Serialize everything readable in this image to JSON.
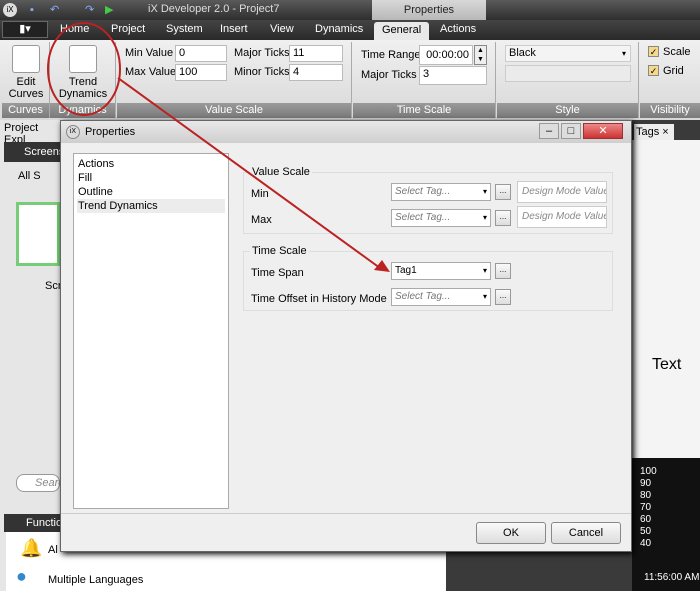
{
  "window": {
    "title": "iX Developer 2.0 - Project7",
    "context_tab": "Properties"
  },
  "tabs": [
    "Home",
    "Project",
    "System",
    "Insert",
    "View",
    "Dynamics",
    "General",
    "Actions"
  ],
  "ribbon": {
    "curves": {
      "edit_curves": "Edit Curves",
      "label": "Curves"
    },
    "dynamics": {
      "trend_dynamics": "Trend Dynamics",
      "label": "Dynamics"
    },
    "value_scale": {
      "label": "Value Scale",
      "min_label": "Min Value",
      "min": "0",
      "max_label": "Max Value",
      "max": "100",
      "major_label": "Major Ticks",
      "major": "11",
      "minor_label": "Minor Ticks",
      "minor": "4"
    },
    "time_scale": {
      "label": "Time Scale",
      "range_label": "Time Range",
      "range": "00:00:00",
      "major_label": "Major Ticks",
      "major": "3"
    },
    "style": {
      "label": "Style",
      "color": "Black"
    },
    "visibility": {
      "label": "Visibility",
      "scale": "Scale",
      "grid": "Grid"
    }
  },
  "left": {
    "project_explorer": "Project Expl",
    "screens": "Screens",
    "all": "All S",
    "screen_name": "Scr",
    "search": "Searc",
    "functions": "Functio",
    "alarm": "Al",
    "languages": "Multiple Languages"
  },
  "right": {
    "tags": "Tags",
    "text": "Text",
    "ticks": [
      "100",
      "90",
      "80",
      "70",
      "60",
      "50",
      "40"
    ],
    "time": "11:56:00 AM"
  },
  "dialog": {
    "title": "Properties",
    "nav": [
      "Actions",
      "Fill",
      "Outline",
      "Trend Dynamics"
    ],
    "value_scale": {
      "legend": "Value Scale",
      "min": "Min",
      "max": "Max",
      "tag_placeholder": "Select Tag...",
      "design_placeholder": "Design Mode Value"
    },
    "time_scale": {
      "legend": "Time Scale",
      "span": "Time Span",
      "span_value": "Tag1",
      "offset": "Time Offset in History Mode",
      "tag_placeholder": "Select Tag..."
    },
    "ok": "OK",
    "cancel": "Cancel"
  }
}
